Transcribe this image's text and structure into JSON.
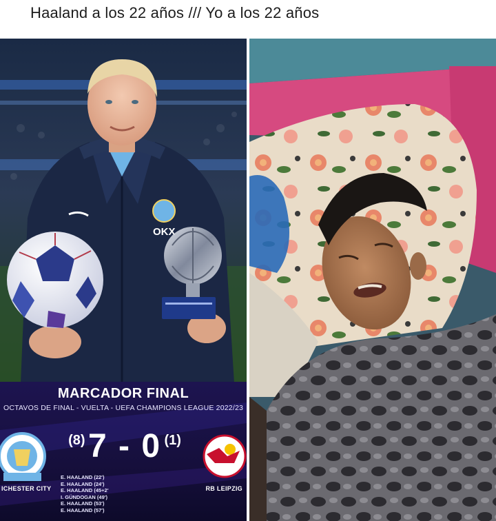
{
  "caption": "Haaland a los 22 años ///   Yo a los 22 años",
  "left_panel": {
    "jacket_brand": "OKX",
    "scoreboard": {
      "title": "MARCADOR FINAL",
      "subtitle": "OCTAVOS DE FINAL - VUELTA - UEFA CHAMPIONS LEAGUE 2022/23",
      "home_agg": "(8)",
      "score": "7 - 0",
      "away_agg": "(1)",
      "home_team": "ICHESTER CITY",
      "away_team": "RB LEIPZIG",
      "scorers": [
        "E. HAALAND (22')",
        "E. HAALAND (24')",
        "E. HAALAND (45+2'",
        "I. GÜNDOGAN (49')",
        "E. HAALAND (53')",
        "E. HAALAND (57')"
      ]
    }
  },
  "colors": {
    "jacket": "#1b2744",
    "stadium": "#0e1a2e",
    "scoreboard": "#1d1450",
    "wall": "#e0467e",
    "blanket": "#5b5a5e"
  }
}
